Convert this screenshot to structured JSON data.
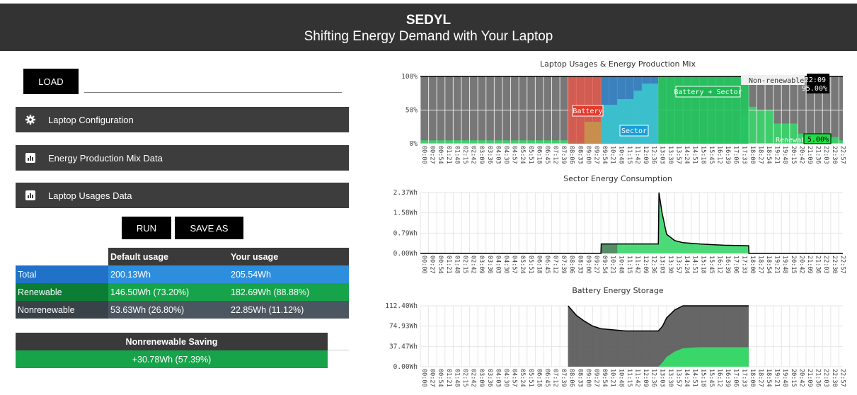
{
  "header": {
    "title": "SEDYL",
    "subtitle": "Shifting Energy Demand with Your Laptop"
  },
  "load_button": "LOAD",
  "sections": [
    {
      "label": "Laptop Configuration",
      "icon": "gear-icon"
    },
    {
      "label": "Energy Production Mix Data",
      "icon": "bar-chart-icon"
    },
    {
      "label": "Laptop Usages Data",
      "icon": "bar-chart-icon"
    }
  ],
  "run_button": "RUN",
  "save_as_button": "SAVE AS",
  "results": {
    "headers": [
      "",
      "Default usage",
      "Your usage"
    ],
    "rows": [
      {
        "label": "Total",
        "default": "200.13Wh",
        "yours": "205.54Wh"
      },
      {
        "label": "Renewable",
        "default": "146.50Wh (73.20%)",
        "yours": "182.69Wh (88.88%)"
      },
      {
        "label": "Nonrenewable",
        "default": "53.63Wh (26.80%)",
        "yours": "22.85Wh (11.12%)"
      }
    ]
  },
  "saving": {
    "title": "Nonrenewable Saving",
    "value": "+30.78Wh (57.39%)"
  },
  "time_ticks": [
    "00:00",
    "00:27",
    "00:54",
    "01:21",
    "01:48",
    "02:15",
    "02:42",
    "03:09",
    "03:36",
    "04:03",
    "04:30",
    "04:57",
    "05:24",
    "05:51",
    "06:18",
    "06:45",
    "07:12",
    "07:39",
    "08:06",
    "08:33",
    "09:00",
    "09:27",
    "09:54",
    "10:21",
    "10:48",
    "11:15",
    "11:42",
    "12:09",
    "12:36",
    "13:03",
    "13:30",
    "13:57",
    "14:24",
    "14:51",
    "15:18",
    "15:45",
    "16:12",
    "16:39",
    "17:06",
    "17:33",
    "18:00",
    "18:27",
    "18:54",
    "19:21",
    "19:48",
    "20:15",
    "20:42",
    "21:09",
    "21:36",
    "22:03",
    "22:30",
    "22:57"
  ],
  "colors": {
    "nonrenewable": "#777777",
    "renewable": "#39d66a",
    "battery": "#e0574a",
    "sector": "#3cc2cc",
    "battery_sector": "#22c55e",
    "header": "#333333"
  },
  "chart_data": [
    {
      "type": "area",
      "title": "Laptop Usages & Energy Production Mix",
      "yticks": [
        "0%",
        "50%",
        "100%"
      ],
      "ylim": [
        0,
        100
      ],
      "x_range": [
        "00:00",
        "23:10"
      ],
      "production_mix": {
        "x": [
          "00:00",
          "17:06",
          "17:33",
          "18:00",
          "18:27",
          "19:21",
          "20:42",
          "21:36",
          "22:57",
          "23:10"
        ],
        "renewable_percent": [
          5,
          5,
          45,
          55,
          50,
          30,
          15,
          10,
          5,
          5
        ]
      },
      "usage_blocks": [
        {
          "label": "Battery",
          "start": "08:06",
          "end": "09:54",
          "color": "battery"
        },
        {
          "label": "Sector",
          "start": "09:54",
          "end": "13:03",
          "color": "sector"
        },
        {
          "label": "Battery + Sector",
          "start": "13:03",
          "end": "18:00",
          "color": "battery_sector"
        }
      ],
      "tooltips": [
        {
          "series": "Non-renewable",
          "time": "22:09",
          "value": "95.00%"
        },
        {
          "series": "Renewable",
          "value": "5.00%"
        }
      ]
    },
    {
      "type": "area",
      "title": "Sector Energy Consumption",
      "yticks": [
        "0.00Wh",
        "0.79Wh",
        "1.58Wh",
        "2.37Wh"
      ],
      "ylim": [
        0,
        2.37
      ],
      "x": [
        "00:00",
        "08:06",
        "09:54",
        "09:55",
        "11:15",
        "12:09",
        "12:45",
        "13:03",
        "13:05",
        "13:15",
        "13:30",
        "13:57",
        "14:24",
        "15:18",
        "16:39",
        "18:00",
        "18:01",
        "23:10"
      ],
      "values": [
        0,
        0,
        0,
        0.37,
        0.37,
        0.37,
        0.37,
        0.37,
        2.37,
        1.6,
        0.75,
        0.5,
        0.42,
        0.37,
        0.32,
        0.3,
        0,
        0
      ]
    },
    {
      "type": "area",
      "title": "Battery Energy Storage",
      "yticks": [
        "0.00Wh",
        "37.47Wh",
        "74.93Wh",
        "112.40Wh"
      ],
      "ylim": [
        0,
        112.4
      ],
      "x": [
        "08:06",
        "08:33",
        "09:00",
        "09:27",
        "09:54",
        "11:15",
        "12:36",
        "13:03",
        "13:17",
        "13:30",
        "13:57",
        "14:24",
        "15:18",
        "18:00"
      ],
      "stored": [
        112.4,
        95,
        84,
        75,
        70,
        66,
        66,
        66,
        75,
        90,
        105,
        112.4,
        112.4,
        112.4
      ],
      "charged_from_renewable": [
        0,
        0,
        0,
        0,
        0,
        0,
        0,
        0,
        8,
        18,
        28,
        34,
        36,
        36
      ]
    }
  ]
}
